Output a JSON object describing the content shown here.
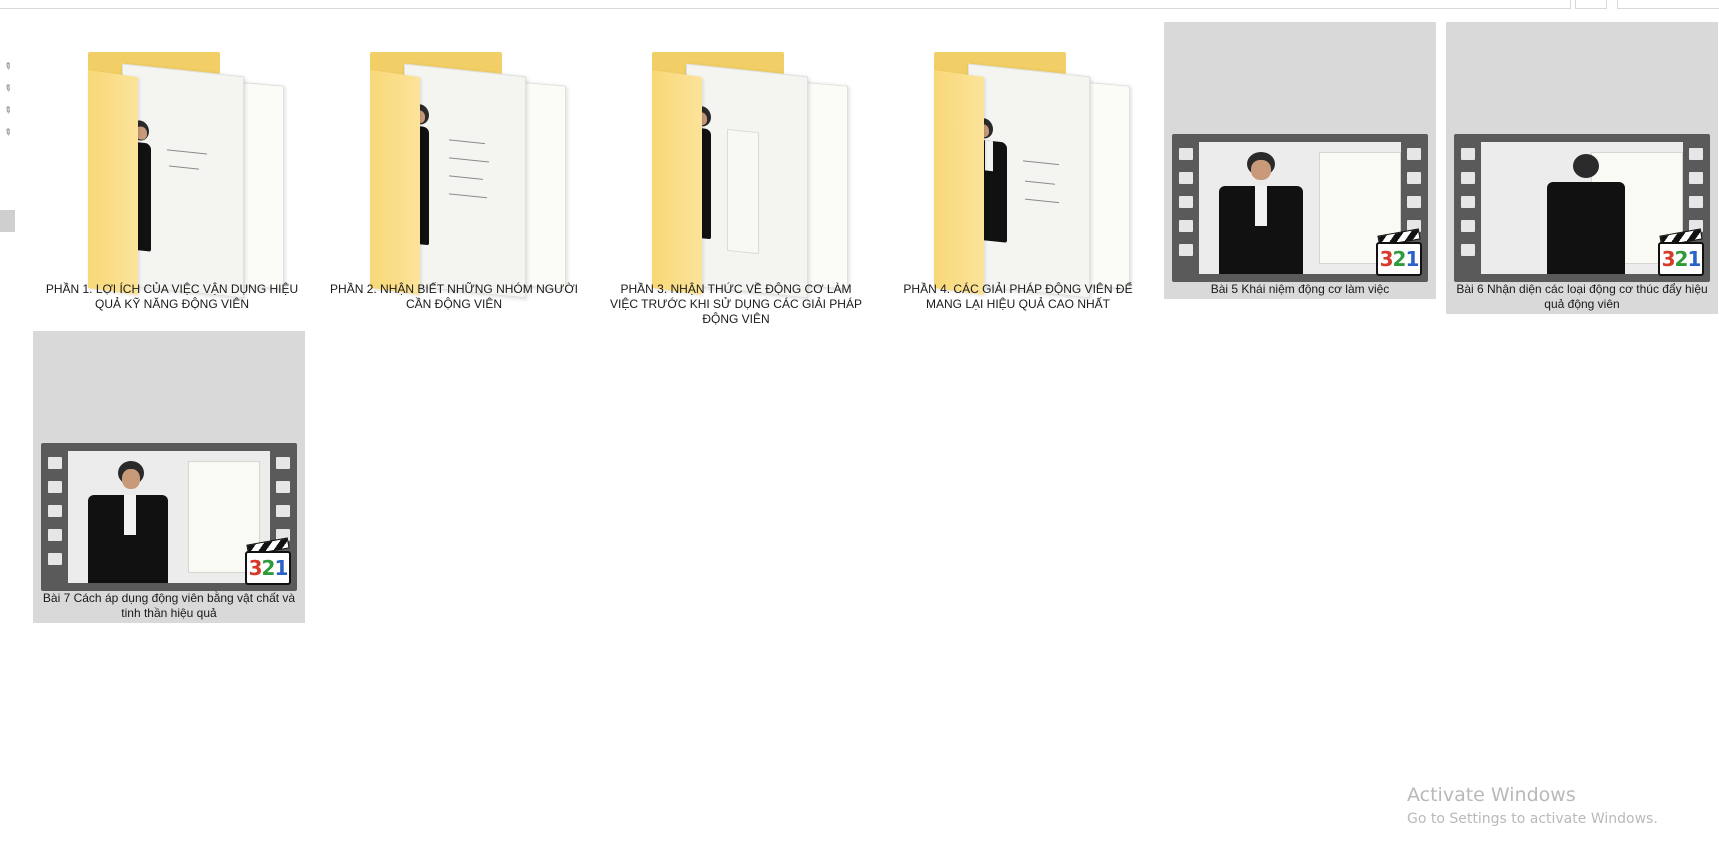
{
  "items": [
    {
      "type": "folder",
      "name": "PHẦN 1. LỢI ÍCH CỦA VIỆC VẬN DỤNG HIỆU QUẢ KỸ NĂNG ĐỘNG VIÊN"
    },
    {
      "type": "folder",
      "name": "PHẦN 2. NHẬN BIẾT NHỮNG NHÓM NGƯỜI CẦN ĐỘNG VIÊN"
    },
    {
      "type": "folder",
      "name": "PHẦN 3. NHẬN THỨC VỀ ĐỘNG CƠ LÀM VIỆC TRƯỚC KHI SỬ DỤNG CÁC GIẢI PHÁP ĐỘNG VIÊN"
    },
    {
      "type": "folder",
      "name": "PHẦN 4. CÁC GIẢI PHÁP ĐỘNG VIÊN ĐỂ MANG LẠI HIỆU QUẢ CAO NHẤT"
    },
    {
      "type": "video",
      "name": "Bài 5 Khái niệm động cơ làm việc",
      "selected": true
    },
    {
      "type": "video",
      "name": "Bài 6 Nhận diện các loại động cơ thúc đẩy hiệu quả động viên",
      "selected": true
    },
    {
      "type": "video",
      "name": "Bài 7 Cách áp dụng động viên bằng vật chất và tinh thần hiệu quả",
      "selected": true
    }
  ],
  "badge": {
    "d1": "3",
    "d2": "2",
    "d3": "1"
  },
  "watermark": {
    "title": "Activate Windows",
    "subtitle": "Go to Settings to activate Windows."
  },
  "colors": {
    "selection": "#d9d9d9",
    "folder": "#f8d877",
    "film": "#5a5a5a"
  }
}
